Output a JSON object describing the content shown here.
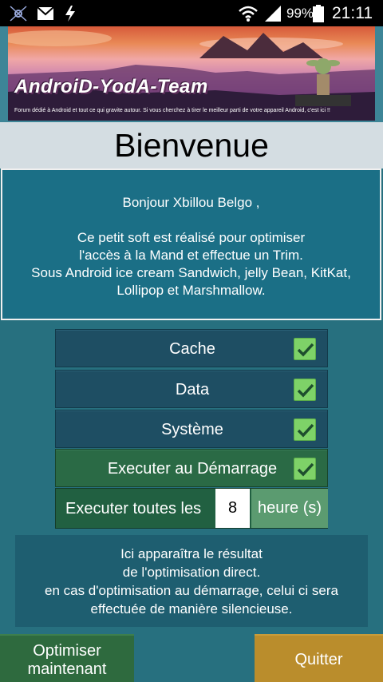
{
  "status_bar": {
    "battery_percent": "99%",
    "clock": "21:11",
    "icons": [
      "app-icon",
      "gmail-icon",
      "flash-icon",
      "wifi-icon",
      "signal-icon",
      "battery-icon"
    ]
  },
  "banner": {
    "title": "AndroiD-YodA-Team",
    "subtitle": "Forum dédié à Android et tout ce qui gravite autour. Si vous cherchez à tirer le meilleur parti de votre appareil Android, c'est ici !!"
  },
  "welcome": {
    "title": "Bienvenue"
  },
  "intro": {
    "greeting": "Bonjour Xbillou Belgo ,",
    "lines": [
      "Ce petit soft est réalisé pour optimiser",
      "l'accès à la Mand et effectue un Trim.",
      "Sous Android  ice cream Sandwich,  jelly Bean, KitKat,",
      "Lollipop et Marshmallow."
    ]
  },
  "options": [
    {
      "label": "Cache",
      "checked": true
    },
    {
      "label": "Data",
      "checked": true
    },
    {
      "label": "Système",
      "checked": true
    },
    {
      "label": "Executer au Démarrage",
      "checked": true
    }
  ],
  "interval": {
    "label": "Executer toutes les",
    "value": "8",
    "unit_label": "heure (s)"
  },
  "result": {
    "lines": [
      "Ici apparaîtra le résultat",
      "de l'optimisation direct.",
      "en cas d'optimisation au démarrage, celui ci sera",
      "effectuée de manière silencieuse."
    ]
  },
  "buttons": {
    "optimize_line1": "Optimiser",
    "optimize_line2": "maintenant",
    "quit": "Quitter"
  },
  "colors": {
    "background": "#27707f",
    "checkbox": "#7ed268",
    "quit_button": "#ba8d2c",
    "optimize_button": "#2e6a3e"
  }
}
